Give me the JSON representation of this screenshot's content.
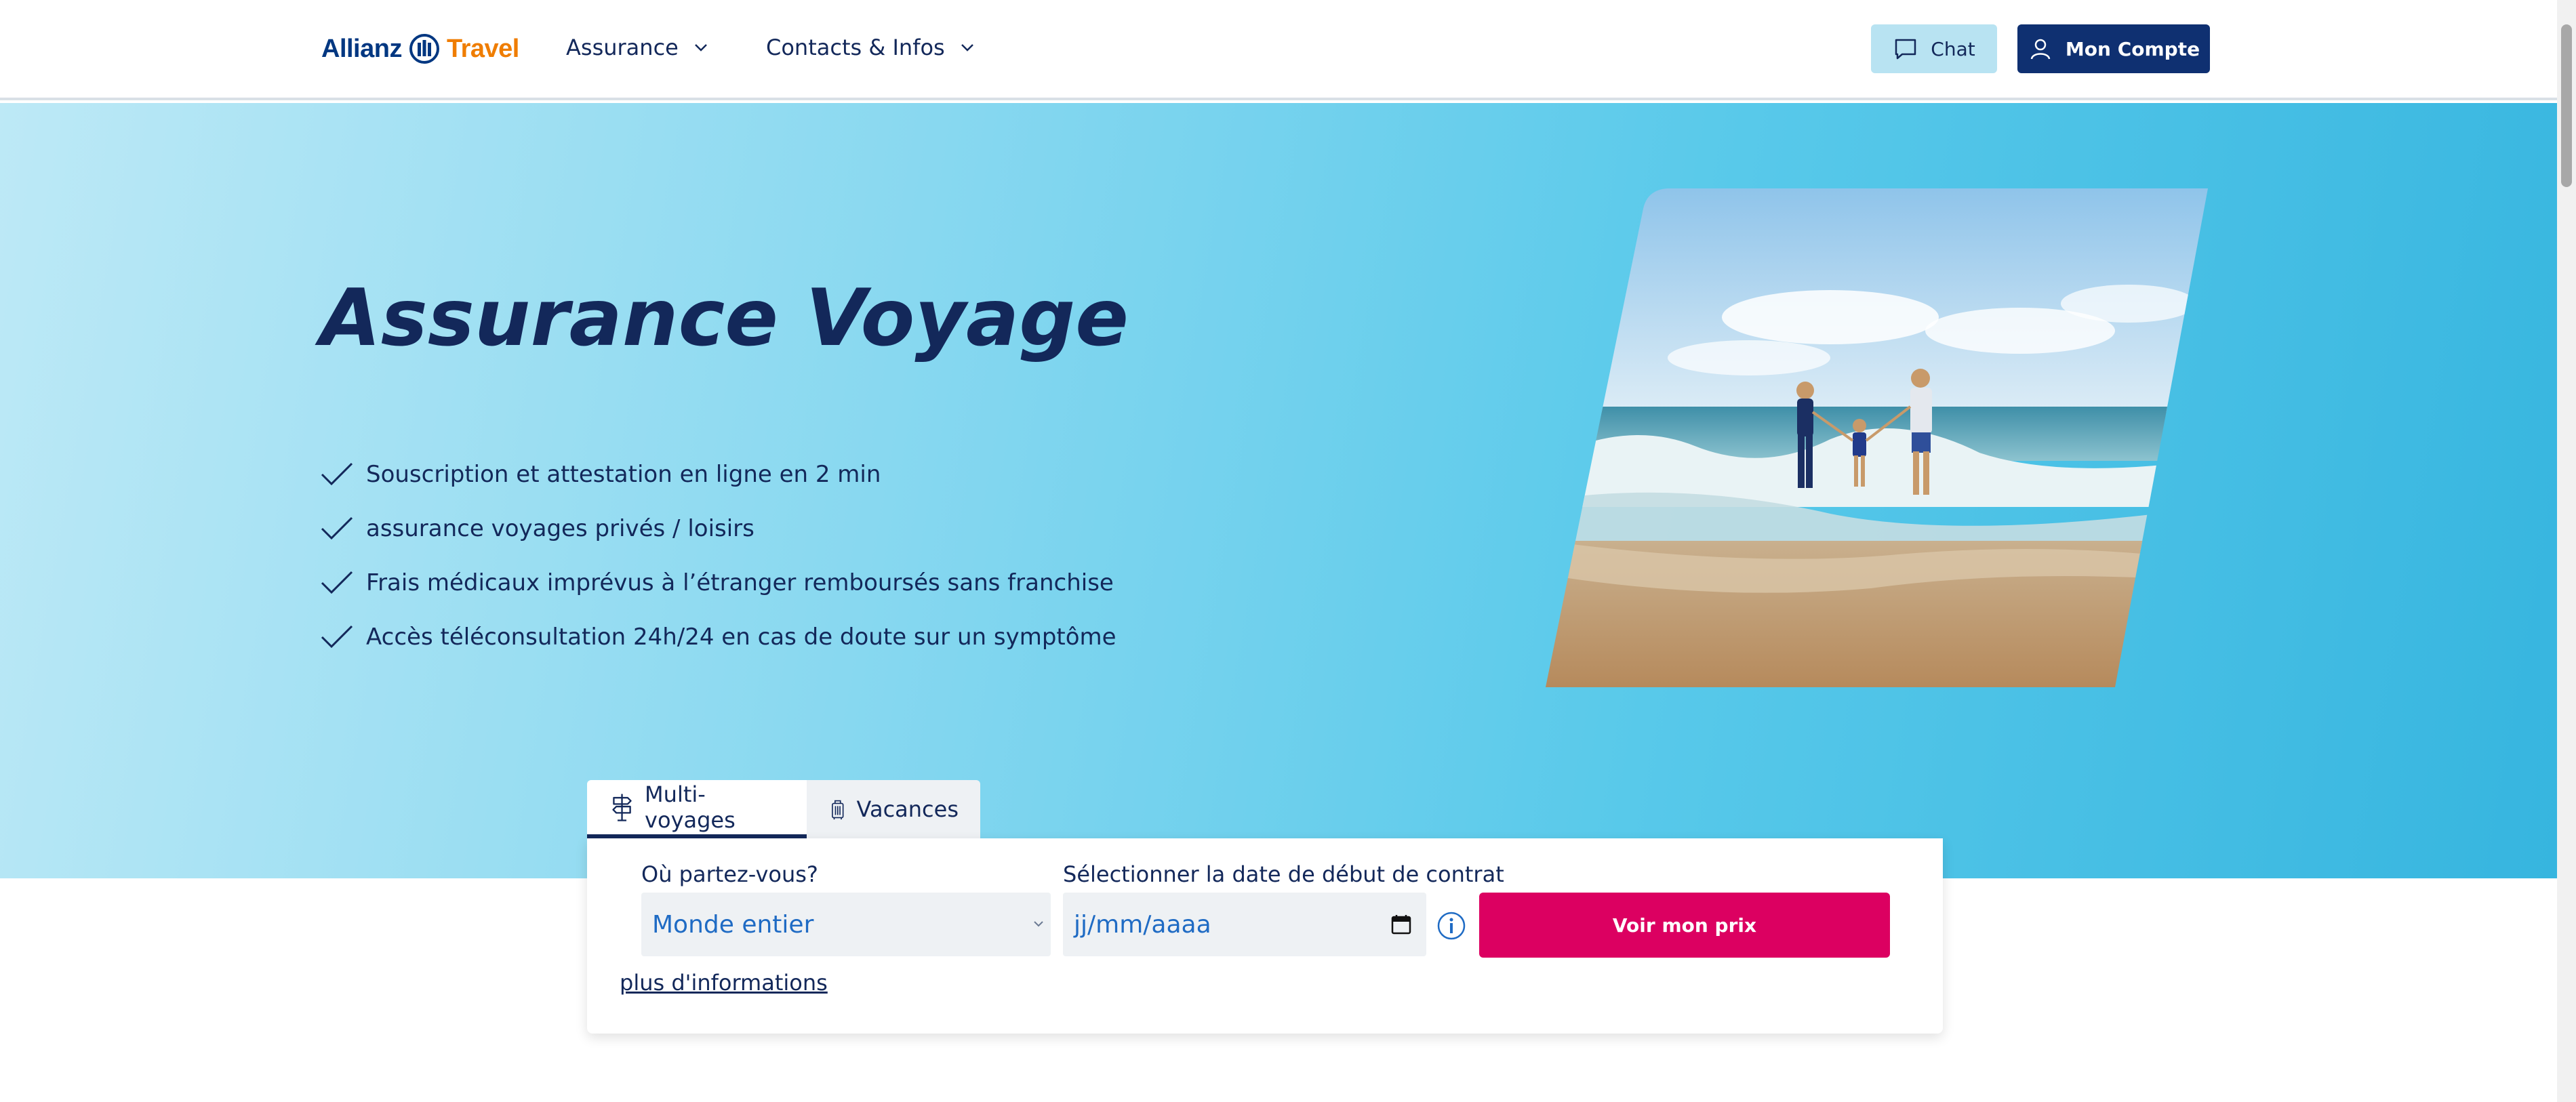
{
  "header": {
    "logo_left": "Allianz",
    "logo_right": "Travel",
    "nav": [
      {
        "label": "Assurance"
      },
      {
        "label": "Contacts & Infos"
      }
    ],
    "chat_label": "Chat",
    "account_label": "Mon Compte"
  },
  "hero": {
    "title": "Assurance Voyage",
    "features": [
      "Souscription et attestation en ligne en 2 min",
      "assurance voyages privés / loisirs",
      "Frais médicaux imprévus à l’étranger remboursés sans franchise",
      "Accès téléconsultation 24h/24 en cas de doute sur un symptôme"
    ]
  },
  "form": {
    "tabs": [
      {
        "label": "Multi-voyages",
        "icon": "signpost-icon",
        "active": true
      },
      {
        "label": "Vacances",
        "icon": "suitcase-icon",
        "active": false
      }
    ],
    "destination_label": "Où partez-vous?",
    "destination_value": "Monde entier",
    "date_label": "Sélectionner la date de début de contrat",
    "date_placeholder": "jj/mm/aaaa",
    "submit_label": "Voir mon prix",
    "more_link": "plus d'informations"
  },
  "colors": {
    "navy": "#13285a",
    "brand_blue": "#003781",
    "brand_orange": "#ef7d00",
    "cta_pink": "#dc0061",
    "chat_bg": "#b8e3f2"
  }
}
